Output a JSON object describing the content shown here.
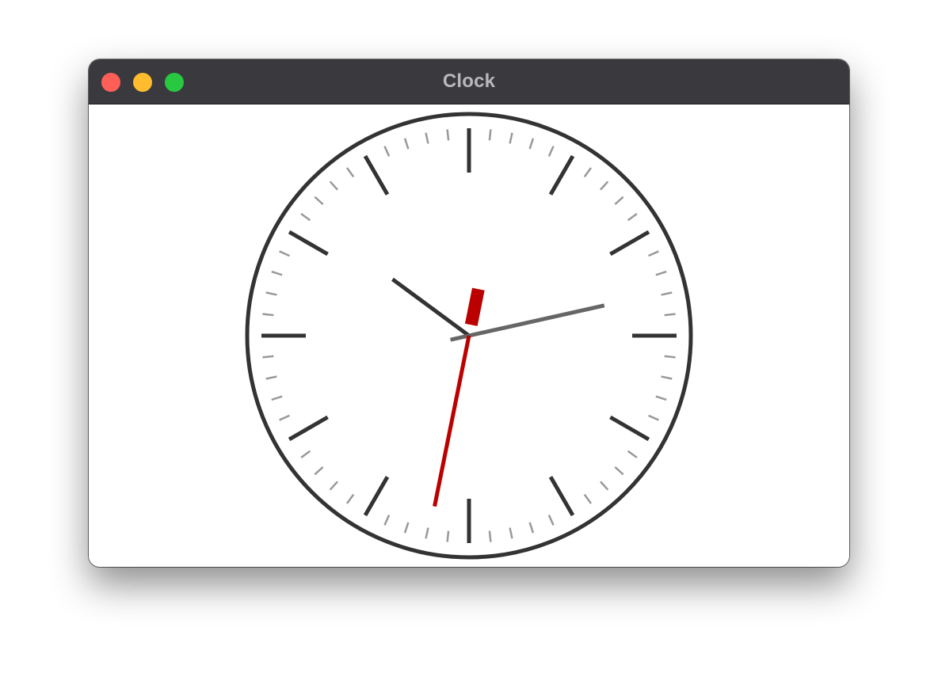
{
  "window": {
    "title": "Clock",
    "buttons": {
      "close": {
        "color": "#ff5f57"
      },
      "minimize": {
        "color": "#febc2e"
      },
      "zoom": {
        "color": "#28c840"
      }
    }
  },
  "clock": {
    "time": {
      "hours": 10,
      "minutes": 12.9,
      "seconds": 31.9
    },
    "colors": {
      "rim": "#333333",
      "hour_tick": "#333333",
      "minute_tick": "#999999",
      "hour_hand": "#333333",
      "minute_hand": "#666666",
      "second_hand": "#bb0000"
    }
  }
}
